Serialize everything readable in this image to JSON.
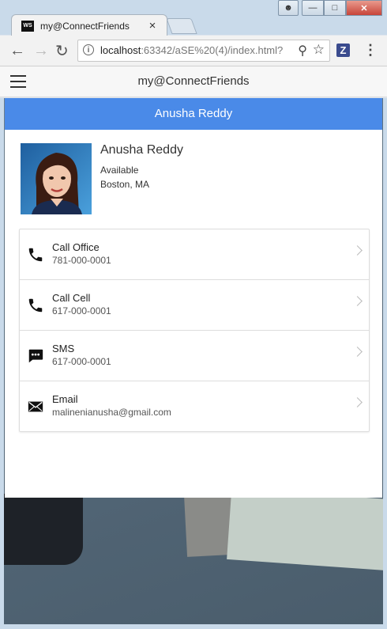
{
  "browser": {
    "tab_title": "my@ConnectFriends",
    "tab_favicon_text": "WS",
    "url_host": "localhost",
    "url_path": ":63342/aSE%20(4)/index.html?",
    "extension_label": "Z"
  },
  "app": {
    "title": "my@ConnectFriends"
  },
  "contact": {
    "header_name": "Anusha Reddy",
    "name": "Anusha Reddy",
    "status": "Available",
    "location": "Boston, MA"
  },
  "actions": [
    {
      "label": "Call Office",
      "value": "781-000-0001",
      "icon": "phone-icon"
    },
    {
      "label": "Call Cell",
      "value": "617-000-0001",
      "icon": "phone-icon"
    },
    {
      "label": "SMS",
      "value": "617-000-0001",
      "icon": "sms-icon"
    },
    {
      "label": "Email",
      "value": "malinenianusha@gmail.com",
      "icon": "email-icon"
    }
  ],
  "colors": {
    "header_blue": "#4a8ae8"
  }
}
